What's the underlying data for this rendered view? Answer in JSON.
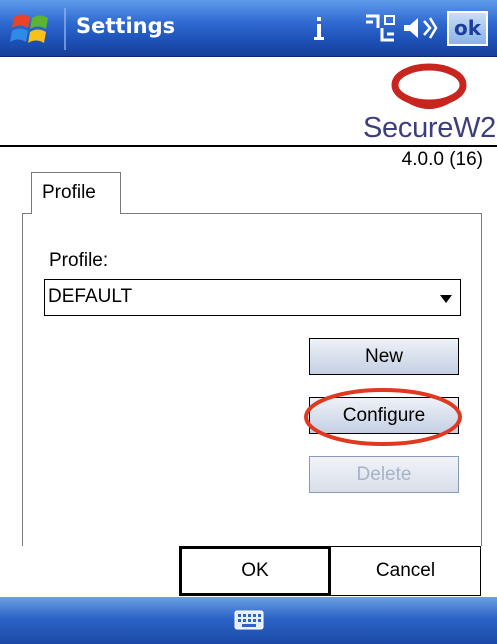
{
  "titlebar": {
    "title": "Settings",
    "ok_label": "ok",
    "icons": [
      "windows-start-icon",
      "connectivity-icon",
      "network-icon",
      "volume-icon"
    ]
  },
  "header": {
    "logo_text": "SecureW2",
    "version": "4.0.0 (16)"
  },
  "tabs": [
    {
      "label": "Profile",
      "selected": true
    }
  ],
  "profile": {
    "label": "Profile:",
    "selected_value": "DEFAULT",
    "new_label": "New",
    "configure_label": "Configure",
    "delete_label": "Delete",
    "delete_enabled": false
  },
  "dialog": {
    "ok_label": "OK",
    "cancel_label": "Cancel"
  },
  "softkeys": {
    "icon": "keyboard-icon"
  },
  "colors": {
    "titlebar_blue": "#2f6ad2",
    "highlight_red": "#e0391f",
    "logo_red": "#c8251e",
    "logo_text": "#3d3f7c"
  }
}
